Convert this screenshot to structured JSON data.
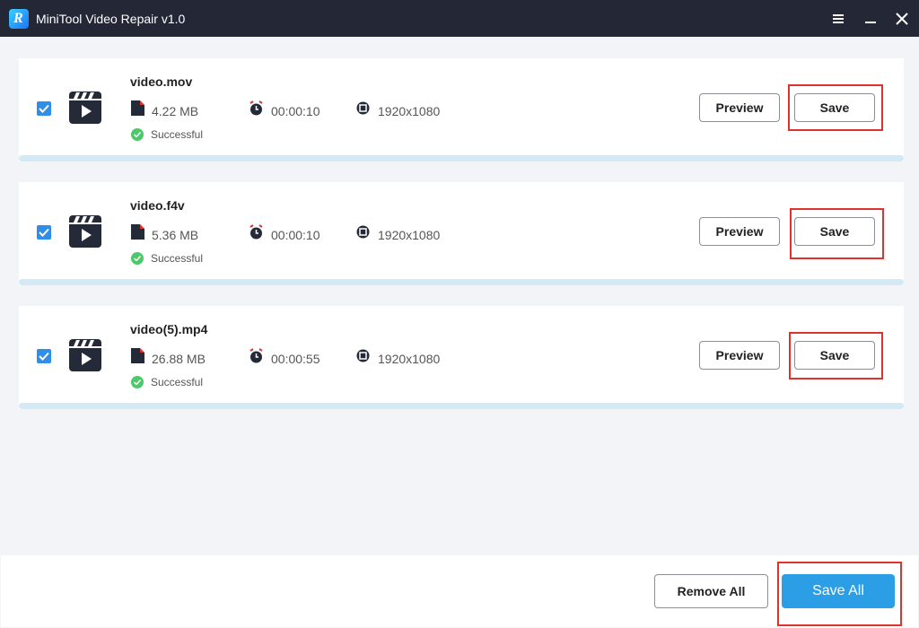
{
  "window": {
    "title": "MiniTool Video Repair v1.0",
    "logo_letter": "R",
    "menu_icon": "hamburger-icon",
    "minimize_icon": "minimize-icon",
    "close_icon": "close-icon"
  },
  "files": [
    {
      "name": "video.mov",
      "size": "4.22 MB",
      "duration": "00:00:10",
      "resolution": "1920x1080",
      "status": "Successful",
      "checked": true,
      "preview_label": "Preview",
      "save_label": "Save"
    },
    {
      "name": "video.f4v",
      "size": "5.36 MB",
      "duration": "00:00:10",
      "resolution": "1920x1080",
      "status": "Successful",
      "checked": true,
      "preview_label": "Preview",
      "save_label": "Save"
    },
    {
      "name": "video(5).mp4",
      "size": "26.88 MB",
      "duration": "00:00:55",
      "resolution": "1920x1080",
      "status": "Successful",
      "checked": true,
      "preview_label": "Preview",
      "save_label": "Save"
    }
  ],
  "footer": {
    "remove_all_label": "Remove All",
    "save_all_label": "Save All"
  },
  "colors": {
    "titlebar": "#232736",
    "accent": "#2c9ee6",
    "success": "#4dc86b",
    "highlight": "#e0332d"
  }
}
